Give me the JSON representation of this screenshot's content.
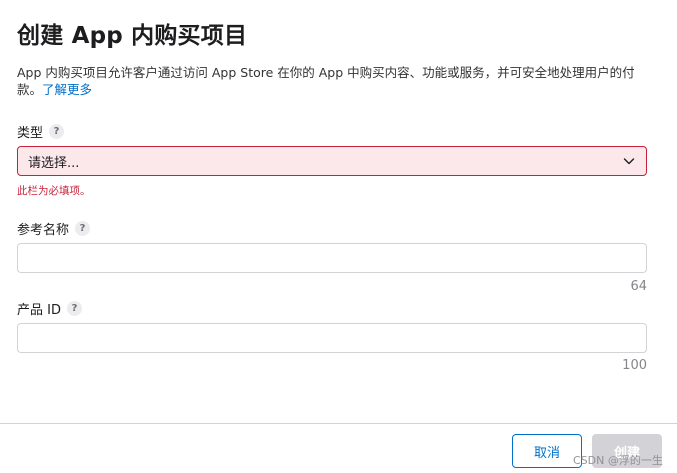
{
  "dialog": {
    "title": "创建 App 内购买项目",
    "description": "App 内购买项目允许客户通过访问 App Store 在你的 App 中购买内容、功能或服务，并可安全地处理用户的付款。",
    "learn_more": "了解更多"
  },
  "fields": {
    "type": {
      "label": "类型",
      "help": "?",
      "selected": "请选择...",
      "error": "此栏为必填项。"
    },
    "reference_name": {
      "label": "参考名称",
      "help": "?",
      "value": "",
      "max_length": "64"
    },
    "product_id": {
      "label": "产品 ID",
      "help": "?",
      "value": "",
      "max_length": "100"
    }
  },
  "buttons": {
    "cancel": "取消",
    "create": "创建"
  },
  "watermark": "CSDN @浮的一生",
  "colors": {
    "accent": "#0070c9",
    "error": "#c6233b",
    "error_bg": "#fce8ea",
    "disabled": "#d2d2d7"
  },
  "icons": {
    "select_chevron": "chevron-down-icon",
    "help": "help-icon"
  }
}
